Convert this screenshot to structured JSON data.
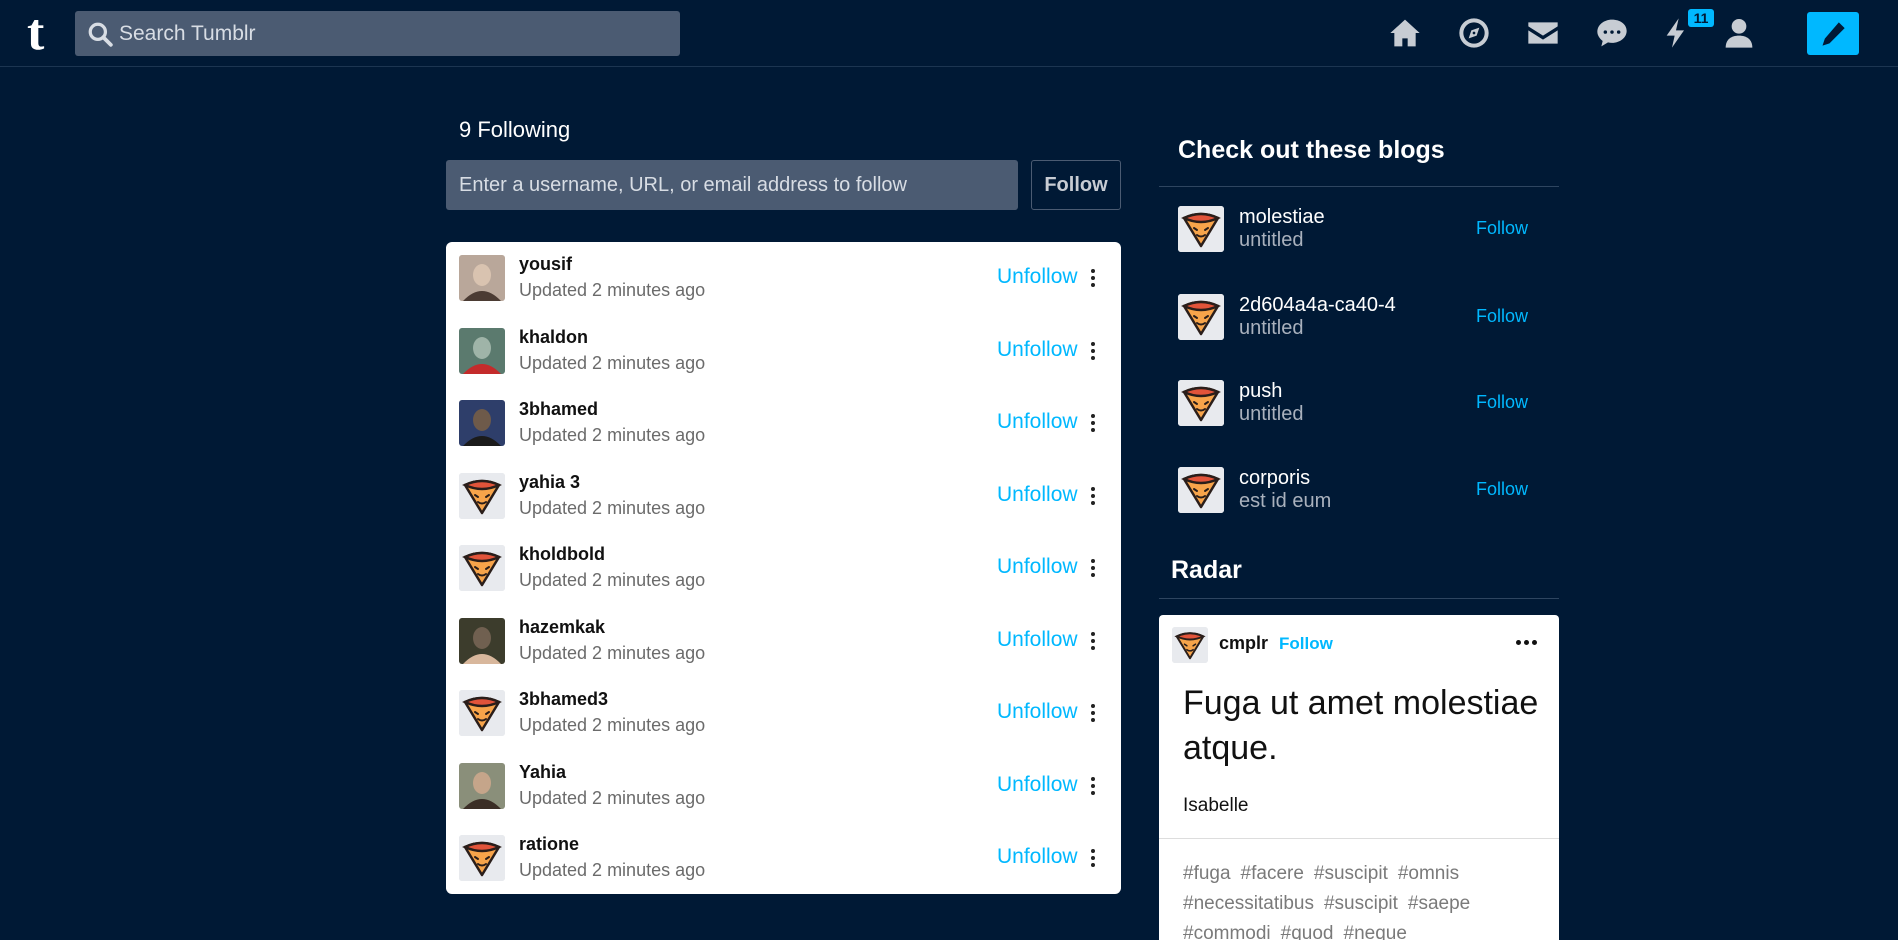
{
  "header": {
    "logo": "t",
    "search_placeholder": "Search Tumblr",
    "notification_count": "11",
    "icons": [
      "home-icon",
      "explore-icon",
      "inbox-icon",
      "messages-icon",
      "activity-icon",
      "account-icon",
      "compose-icon"
    ],
    "accent_color": "#00b8ff"
  },
  "following": {
    "title": "9 Following",
    "input_placeholder": "Enter a username, URL, or email address to follow",
    "follow_button": "Follow",
    "unfollow_label": "Unfollow",
    "items": [
      {
        "name": "yousif",
        "updated": "Updated 2 minutes ago",
        "avatar": "photo"
      },
      {
        "name": "khaldon",
        "updated": "Updated 2 minutes ago",
        "avatar": "photo"
      },
      {
        "name": "3bhamed",
        "updated": "Updated 2 minutes ago",
        "avatar": "photo"
      },
      {
        "name": "yahia 3",
        "updated": "Updated 2 minutes ago",
        "avatar": "cone"
      },
      {
        "name": "kholdbold",
        "updated": "Updated 2 minutes ago",
        "avatar": "cone"
      },
      {
        "name": "hazemkak",
        "updated": "Updated 2 minutes ago",
        "avatar": "photo"
      },
      {
        "name": "3bhamed3",
        "updated": "Updated 2 minutes ago",
        "avatar": "cone"
      },
      {
        "name": "Yahia",
        "updated": "Updated 2 minutes ago",
        "avatar": "photo"
      },
      {
        "name": "ratione",
        "updated": "Updated 2 minutes ago",
        "avatar": "cone"
      }
    ]
  },
  "recommended": {
    "title": "Check out these blogs",
    "follow_label": "Follow",
    "items": [
      {
        "name": "molestiae",
        "subtitle": "untitled"
      },
      {
        "name": "2d604a4a-ca40-4",
        "subtitle": "untitled"
      },
      {
        "name": "push",
        "subtitle": "untitled"
      },
      {
        "name": "corporis",
        "subtitle": "est id eum"
      }
    ]
  },
  "radar": {
    "title": "Radar",
    "blog": "cmplr",
    "follow_label": "Follow",
    "heading": "Fuga ut amet molestiae atque.",
    "body": "Isabelle",
    "tags": [
      "#fuga",
      "#facere",
      "#suscipit",
      "#omnis",
      "#necessitatibus",
      "#suscipit",
      "#saepe",
      "#commodi",
      "#quod",
      "#neque"
    ]
  }
}
